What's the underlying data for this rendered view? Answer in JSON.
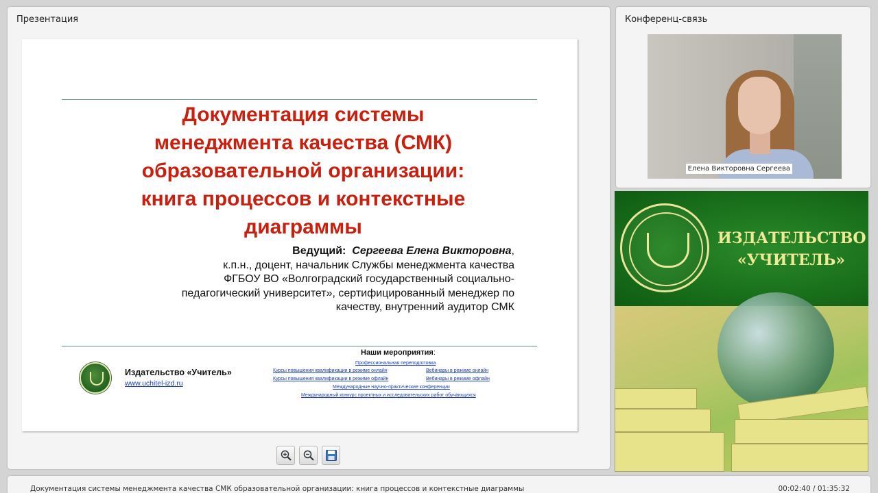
{
  "presentation_panel": {
    "title": "Презентация",
    "slide": {
      "heading_lines": [
        "Документация системы",
        "менеджмента качества (СМК)",
        "образовательной организации:",
        "книга процессов и контекстные",
        "диаграммы"
      ],
      "presenter_prefix": "Ведущий:",
      "presenter_name": "Сергеева Елена Викторовна",
      "presenter_suffix": ",",
      "presenter_lines": [
        "к.п.н., доцент, начальник Службы менеджмента качества",
        "ФГБОУ ВО «Волгоградский государственный социально-",
        "педагогический университет», сертифицированный менеджер по",
        "качеству, внутренний аудитор СМК"
      ],
      "publisher_name": "Издательство «Учитель»",
      "publisher_url": "www.uchitel-izd.ru",
      "events_title": "Наши мероприятия",
      "events_title_suffix": ":",
      "events": [
        "Профессиональная переподготовка",
        "Курсы повышения квалификации в режиме онлайн",
        "Вебинары в режиме онлайн",
        "Курсы повышения квалификации в режиме офлайн",
        "Вебинары в режиме офлайн",
        "Международные научно-практические конференции",
        "Международный конкурс проектных и исследовательских работ обучающихся"
      ]
    },
    "toolbar": {
      "zoom_in_icon": "zoom-in-icon",
      "zoom_out_icon": "zoom-out-icon",
      "save_icon": "save-icon"
    }
  },
  "conference_panel": {
    "title": "Конференц-связь",
    "participant_name": "Елена Викторовна Сергеева"
  },
  "banner": {
    "line1": "ИЗДАТЕЛЬСТВО",
    "line2": "«УЧИТЕЛЬ»",
    "colors": {
      "green": "#1a6f1b",
      "gold": "#f0ea96"
    }
  },
  "status_bar": {
    "title": "Документация системы менеджмента качества СМК образовательной организации: книга процессов и контекстные диаграммы",
    "time": "00:02:40 / 01:35:32"
  },
  "colors": {
    "heading_red": "#c8200f",
    "link_blue": "#1a3ebd",
    "rule": "#5f8f86"
  }
}
